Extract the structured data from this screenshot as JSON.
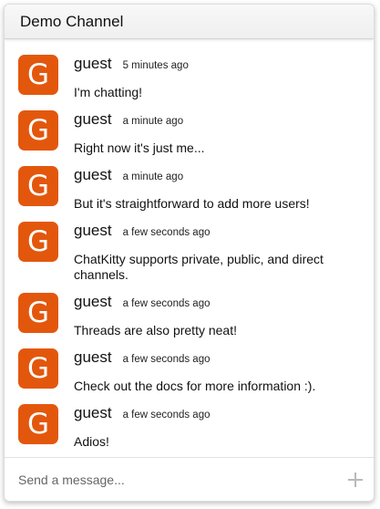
{
  "header": {
    "title": "Demo Channel"
  },
  "messages": [
    {
      "avatar": "G",
      "author": "guest",
      "time": "5 minutes ago",
      "text": "I'm chatting!"
    },
    {
      "avatar": "G",
      "author": "guest",
      "time": "a minute ago",
      "text": "Right now it's just me..."
    },
    {
      "avatar": "G",
      "author": "guest",
      "time": "a minute ago",
      "text": "But it's straightforward to add more users!"
    },
    {
      "avatar": "G",
      "author": "guest",
      "time": "a few seconds ago",
      "text": "ChatKitty supports private, public, and direct channels."
    },
    {
      "avatar": "G",
      "author": "guest",
      "time": "a few seconds ago",
      "text": "Threads are also pretty neat!"
    },
    {
      "avatar": "G",
      "author": "guest",
      "time": "a few seconds ago",
      "text": "Check out the docs for more information :)."
    },
    {
      "avatar": "G",
      "author": "guest",
      "time": "a few seconds ago",
      "text": "Adios!"
    }
  ],
  "composer": {
    "placeholder": "Send a message...",
    "add_icon": "plus-icon"
  },
  "colors": {
    "avatar_bg": "#e3570d",
    "header_bg": "#f2f2f2"
  }
}
